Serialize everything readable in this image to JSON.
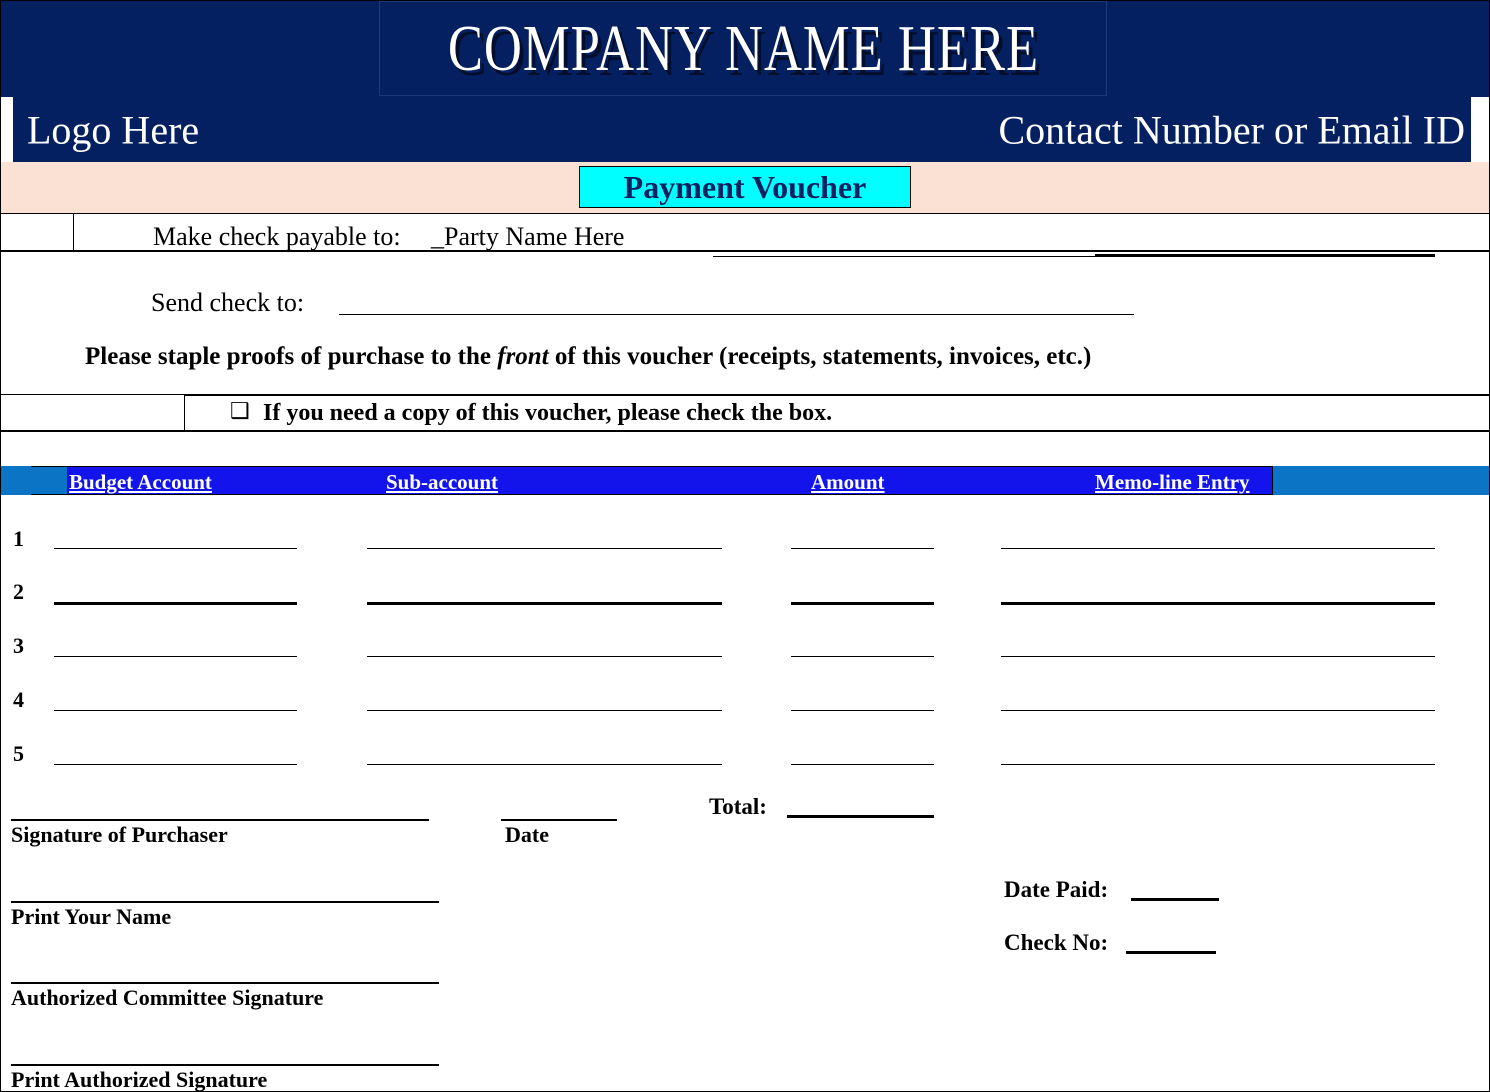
{
  "header": {
    "company_name": "Company Name Here",
    "logo_placeholder": "Logo Here",
    "contact_placeholder": "Contact Number or Email ID",
    "navy_color": "#052060",
    "peach_color": "#fbe0d4",
    "cyan_color": "#00ffff"
  },
  "title": {
    "voucher_title": "Payment Voucher"
  },
  "payable": {
    "label": "Make check payable to:",
    "value": "_Party Name Here"
  },
  "send_check": {
    "label": "Send check to:"
  },
  "staple": {
    "text_before": "Please staple proofs of purchase to the ",
    "emphasis": "front",
    "text_after": " of this voucher (receipts, statements, invoices, etc.)"
  },
  "copy_request": {
    "checkbox_glyph": "❑",
    "text": "If you need a copy of this voucher, please check the box."
  },
  "table": {
    "header_blue": "#1313ec",
    "header_steel": "#0b74c4",
    "columns": [
      {
        "label": "Budget Account"
      },
      {
        "label": "Sub-account"
      },
      {
        "label": "Amount"
      },
      {
        "label": "Memo-line Entry"
      }
    ],
    "rows": [
      {
        "number": "1"
      },
      {
        "number": "2"
      },
      {
        "number": "3"
      },
      {
        "number": "4"
      },
      {
        "number": "5"
      }
    ]
  },
  "totals": {
    "total_label": "Total:"
  },
  "signatures": {
    "signature_of_purchaser": "Signature of Purchaser",
    "date": "Date",
    "print_your_name": "Print Your Name",
    "authorized_committee_signature": "Authorized Committee Signature",
    "print_authorized_signature": "Print Authorized Signature"
  },
  "payment_details": {
    "date_paid_label": "Date Paid:",
    "check_no_label": "Check No:"
  }
}
